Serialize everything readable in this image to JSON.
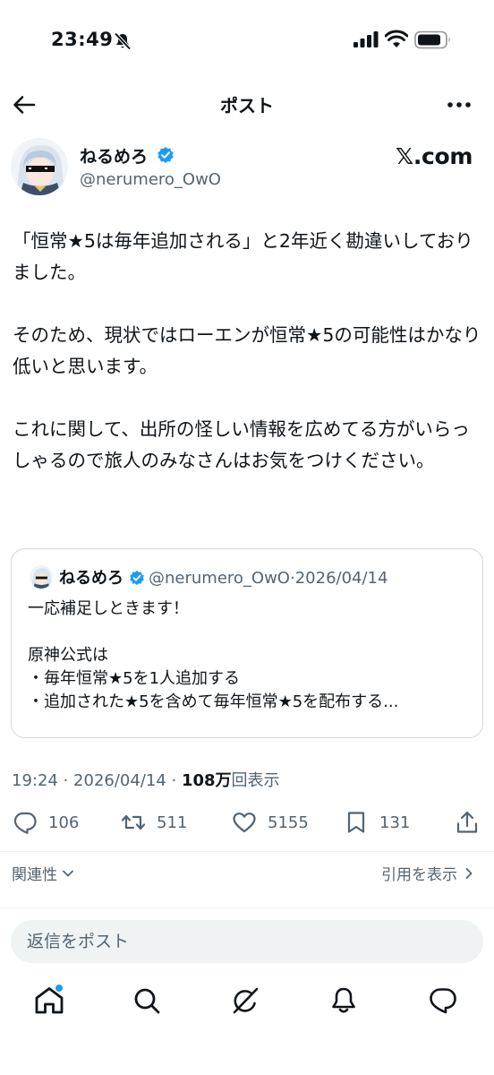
{
  "status_bar": {
    "time": "23:49"
  },
  "header": {
    "title": "ポスト"
  },
  "author": {
    "name": "ねるめろ",
    "handle": "@nerumero_OwO"
  },
  "watermark": "𝕏.com",
  "post": {
    "paragraphs": [
      "「恒常★5は毎年追加される」と2年近く勘違いしておりました。",
      "そのため、現状ではローエンが恒常★5の可能性はかなり低いと思います。",
      "これに関して、出所の怪しい情報を広めてる方がいらっしゃるので旅人のみなさんはお気をつけください。"
    ]
  },
  "quote": {
    "name": "ねるめろ",
    "handle": "@nerumero_OwO",
    "separator": "·",
    "date": "2026/04/14",
    "lines": [
      "一応補足しときます！",
      "",
      "原神公式は",
      "・毎年恒常★5を1人追加する",
      "・追加された★5を含めて毎年恒常★5を配布する..."
    ]
  },
  "meta": {
    "time": "19:24",
    "dot1": " · ",
    "date": "2026/04/14",
    "dot2": " · ",
    "views": "108万",
    "views_label": "回表示"
  },
  "actions": {
    "replies": "106",
    "reposts": "511",
    "likes": "5155",
    "bookmarks": "131"
  },
  "sort": {
    "relevance_label": "関連性",
    "quotes_label": "引用を表示"
  },
  "reply": {
    "placeholder": "返信をポスト"
  },
  "colors": {
    "accent": "#1d9bf0",
    "text": "#0f1419",
    "secondary": "#536471",
    "border": "#cfd9de"
  },
  "icons": [
    "back-arrow-icon",
    "more-icon",
    "verified-badge-icon",
    "reply-icon",
    "repost-icon",
    "like-icon",
    "bookmark-icon",
    "share-icon",
    "home-icon",
    "search-icon",
    "grok-icon",
    "notifications-icon",
    "messages-icon"
  ]
}
